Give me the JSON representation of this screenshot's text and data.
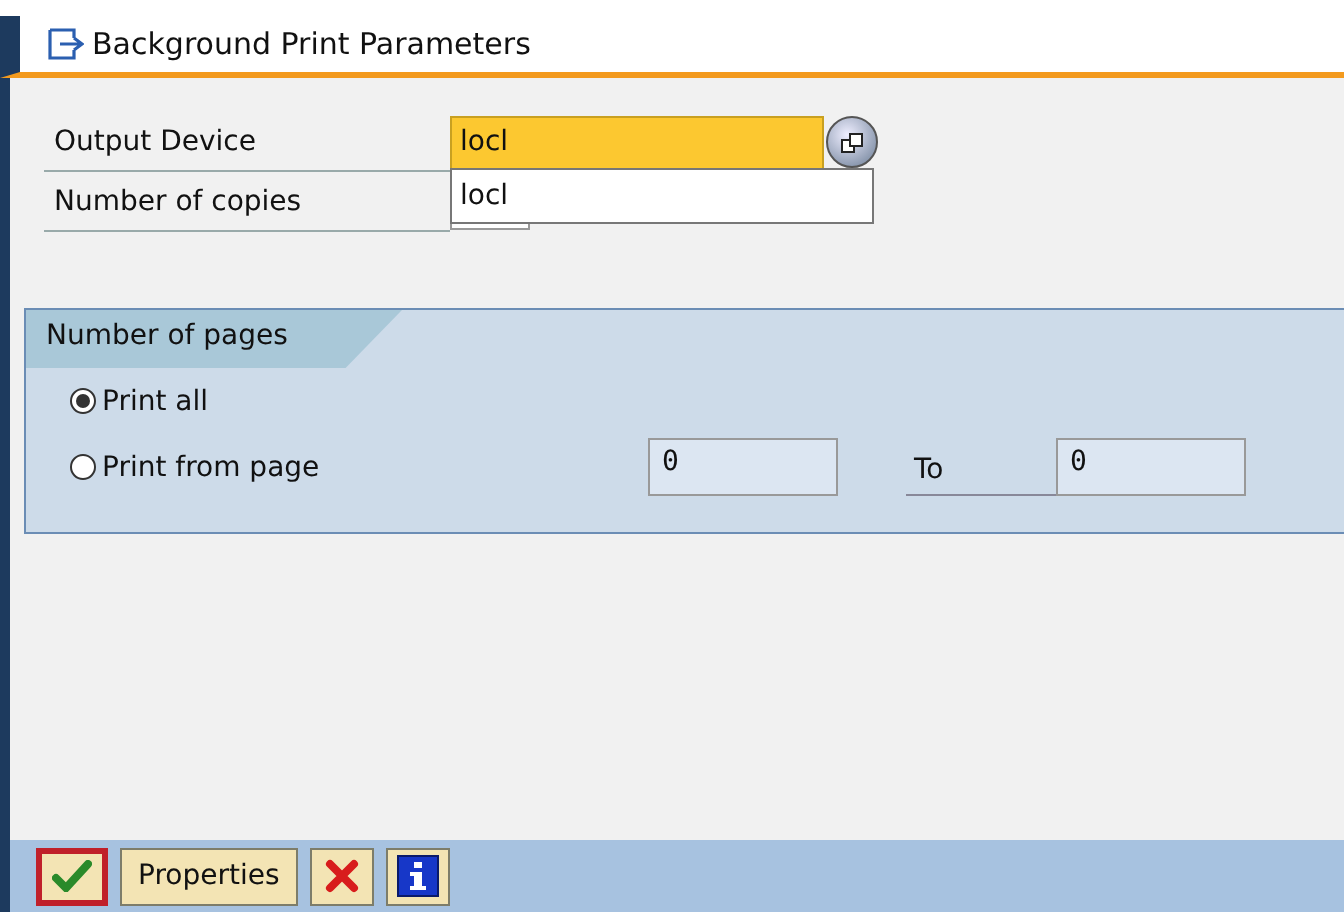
{
  "window": {
    "title": "Background Print Parameters"
  },
  "fields": [
    {
      "label": "Output Device",
      "value": "locl",
      "focused": true,
      "help_button": true
    },
    {
      "label": "Number of copies",
      "focused": false,
      "help_button": false
    }
  ],
  "dropdown": {
    "items": [
      "locl"
    ]
  },
  "pages_group": {
    "title": "Number of pages",
    "options": [
      {
        "label": "Print all",
        "selected": true
      },
      {
        "label": "Print from page",
        "selected": false
      }
    ],
    "from_value": "0",
    "to_label": "To",
    "to_value": "0"
  },
  "toolbar": [
    {
      "kind": "ok",
      "highlighted": true
    },
    {
      "kind": "text",
      "label": "Properties",
      "highlighted": false
    },
    {
      "kind": "cancel",
      "highlighted": false
    },
    {
      "kind": "info",
      "highlighted": false
    }
  ]
}
